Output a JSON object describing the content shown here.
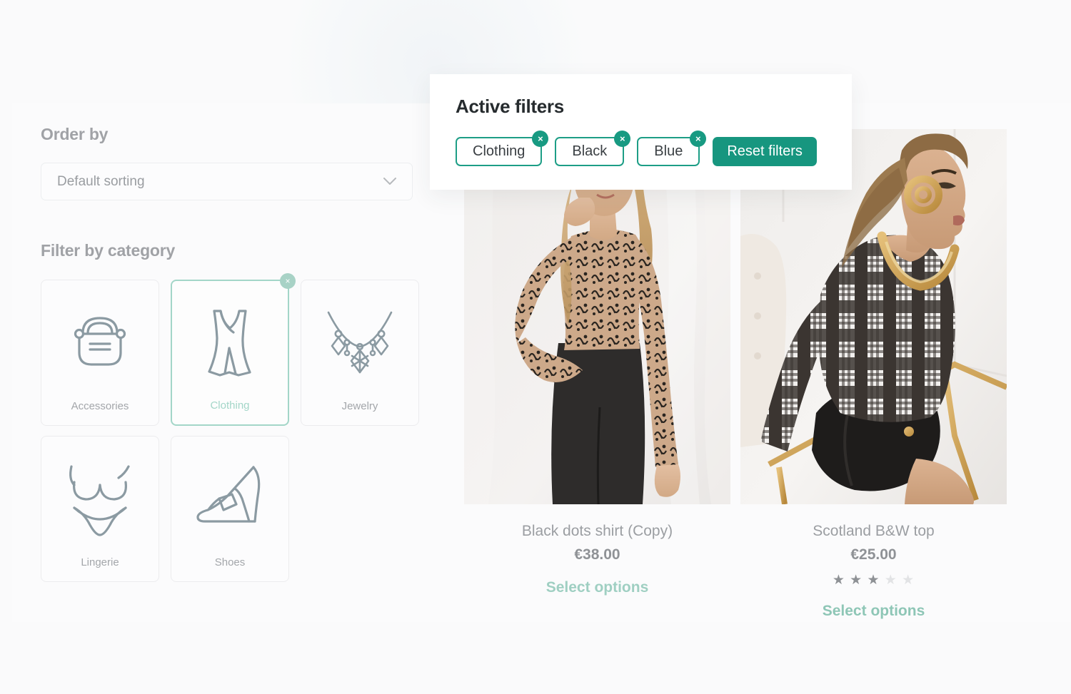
{
  "sidebar": {
    "order_by_label": "Order by",
    "sort": {
      "selected": "Default sorting",
      "chevron_icon": "chevron-down-icon"
    },
    "filter_by_category_label": "Filter by category",
    "categories": [
      {
        "label": "Accessories",
        "icon": "handbag-icon",
        "selected": false
      },
      {
        "label": "Clothing",
        "icon": "dress-icon",
        "selected": true,
        "remove_label": "×"
      },
      {
        "label": "Jewelry",
        "icon": "necklace-icon",
        "selected": false
      },
      {
        "label": "Lingerie",
        "icon": "lingerie-icon",
        "selected": false
      },
      {
        "label": "Shoes",
        "icon": "high-heel-icon",
        "selected": false
      }
    ]
  },
  "products": [
    {
      "title": "Black dots shirt (Copy)",
      "price": "€38.00",
      "cta": "Select options",
      "rating": null
    },
    {
      "title": "Scotland B&W top",
      "price": "€25.00",
      "cta": "Select options",
      "rating": 3,
      "rating_max": 5
    }
  ],
  "active_filters": {
    "title": "Active filters",
    "chips": [
      {
        "label": "Clothing",
        "close_label": "×"
      },
      {
        "label": "Black",
        "close_label": "×"
      },
      {
        "label": "Blue",
        "close_label": "×"
      }
    ],
    "reset_label": "Reset filters"
  },
  "colors": {
    "accent_teal": "#17967F",
    "chip_border": "#1D9E86",
    "muted_teal": "#A3D6C8",
    "text_muted": "#9B9EA2",
    "page_bg": "#FAFAFB"
  }
}
